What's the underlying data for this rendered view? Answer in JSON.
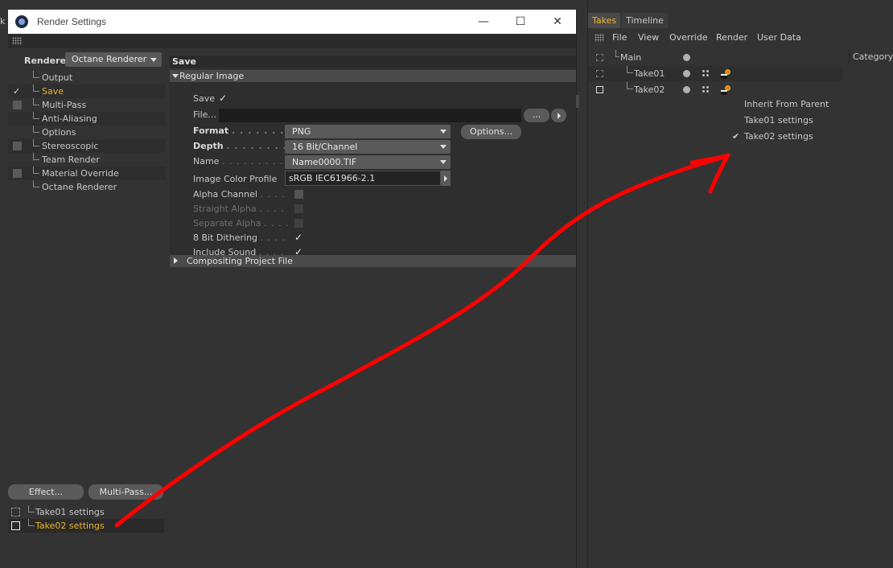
{
  "window": {
    "title": "Render Settings",
    "min_glyph": "—",
    "max_glyph": "☐",
    "close_glyph": "✕"
  },
  "edge_text": "k",
  "renderer": {
    "label": "Renderer",
    "value": "Octane Renderer"
  },
  "tree": [
    {
      "label": "Output",
      "check": "none",
      "active": false
    },
    {
      "label": "Save",
      "check": "tick",
      "active": true
    },
    {
      "label": "Multi-Pass",
      "check": "box",
      "active": false
    },
    {
      "label": "Anti-Aliasing",
      "check": "none",
      "active": false
    },
    {
      "label": "Options",
      "check": "none",
      "active": false
    },
    {
      "label": "Stereoscopic",
      "check": "box",
      "active": false
    },
    {
      "label": "Team Render",
      "check": "none",
      "active": false
    },
    {
      "label": "Material Override",
      "check": "box",
      "active": false
    },
    {
      "label": "Octane Renderer",
      "check": "none",
      "active": false
    }
  ],
  "buttons": {
    "effect": "Effect...",
    "multipass": "Multi-Pass..."
  },
  "take_settings": [
    {
      "label": "Take01 settings",
      "selected": false
    },
    {
      "label": "Take02 settings",
      "selected": true
    }
  ],
  "save": {
    "header": "Save",
    "regular_image": "Regular Image",
    "save_label": "Save",
    "file_label": "File...",
    "browse_label": "...",
    "format_label": "Format",
    "format_value": "PNG",
    "options_label": "Options...",
    "depth_label": "Depth",
    "depth_value": "16 Bit/Channel",
    "name_label": "Name",
    "name_value": "Name0000.TIF",
    "profile_label": "Image Color Profile",
    "profile_value": "sRGB IEC61966-2.1",
    "alpha_label": "Alpha Channel",
    "straight_label": "Straight Alpha",
    "separate_label": "Separate Alpha",
    "dither_label": "8 Bit Dithering",
    "sound_label": "Include Sound",
    "compositing": "Compositing Project File",
    "dots_short": ". . . . . . . . . . . .",
    "dots_mid": ". . . . . .",
    "dots_tiny": ". . . .",
    "tick": "✓"
  },
  "takes_panel": {
    "tabs": [
      "Takes",
      "Timeline"
    ],
    "menu": [
      "File",
      "View",
      "Override",
      "Render",
      "User Data"
    ],
    "category": "Category",
    "rows": [
      {
        "label": "Main"
      },
      {
        "label": "Take01"
      },
      {
        "label": "Take02"
      }
    ],
    "context_menu": [
      {
        "label": "Inherit From Parent",
        "checked": false
      },
      {
        "label": "Take01 settings",
        "checked": false
      },
      {
        "label": "Take02 settings",
        "checked": true
      }
    ],
    "check_glyph": "✔"
  },
  "colors": {
    "accent": "#f0b429",
    "background": "#333333",
    "annotation": "#ff0000"
  }
}
